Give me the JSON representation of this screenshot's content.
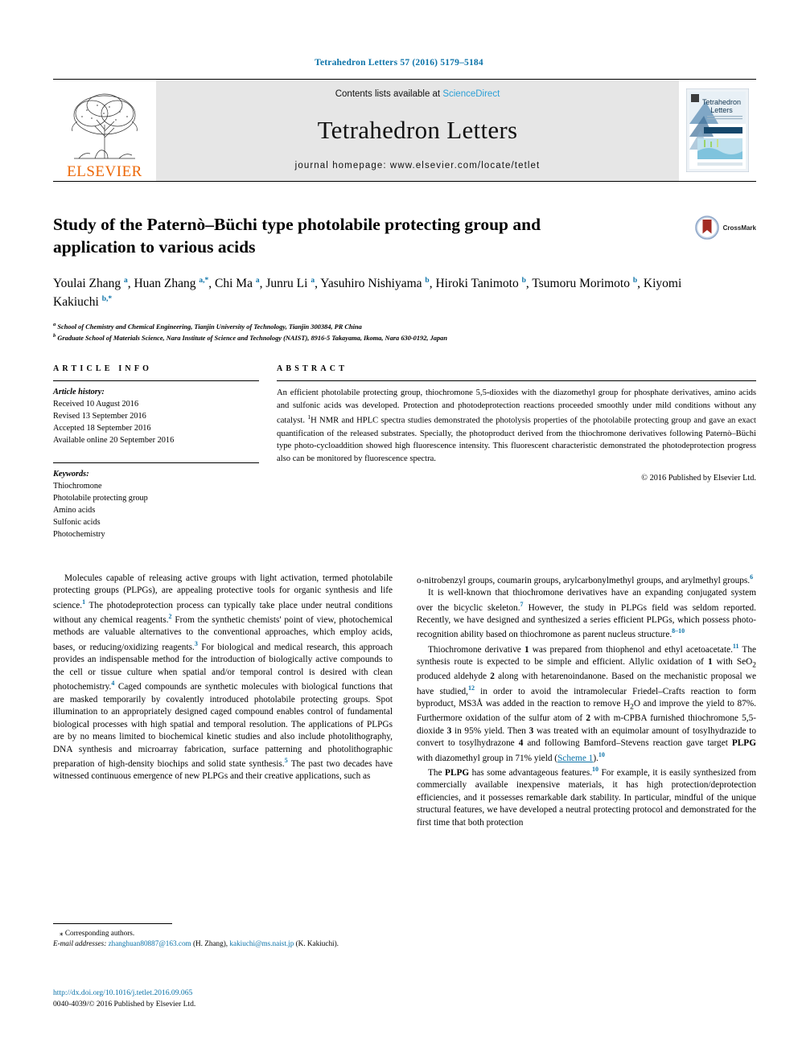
{
  "running_head": "Tetrahedron Letters 57 (2016) 5179–5184",
  "masthead": {
    "contents_prefix": "Contents lists available at ",
    "sciencedirect": "ScienceDirect",
    "journal_name": "Tetrahedron Letters",
    "homepage": "journal homepage: www.elsevier.com/locate/tetlet",
    "publisher_wordmark": "ELSEVIER",
    "cover_title_line1": "Tetrahedron",
    "cover_title_line2": "Letters",
    "accent_blue": "#0b72a8",
    "elsevier_orange": "#ec6707"
  },
  "article": {
    "title": "Study of the Paternò–Büchi type photolabile protecting group and application to various acids",
    "crossmark_label": "CrossMark",
    "authors_html": "Youlai Zhang <sup>a</sup>, Huan Zhang <sup>a,</sup><sup>*</sup>, Chi Ma <sup>a</sup>, Junru Li <sup>a</sup>, Yasuhiro Nishiyama <sup>b</sup>, Hiroki Tanimoto <sup>b</sup>, Tsumoru Morimoto <sup>b</sup>, Kiyomi Kakiuchi <sup>b,</sup><sup>*</sup>",
    "affiliation_a": "School of Chemistry and Chemical Engineering, Tianjin University of Technology, Tianjin 300384, PR China",
    "affiliation_b": "Graduate School of Materials Science, Nara Institute of Science and Technology (NAIST), 8916-5 Takayama, Ikoma, Nara 630-0192, Japan"
  },
  "info": {
    "heading": "ARTICLE INFO",
    "history_label": "Article history:",
    "history": [
      "Received 10 August 2016",
      "Revised 13 September 2016",
      "Accepted 18 September 2016",
      "Available online 20 September 2016"
    ],
    "keywords_label": "Keywords:",
    "keywords": [
      "Thiochromone",
      "Photolabile protecting group",
      "Amino acids",
      "Sulfonic acids",
      "Photochemistry"
    ]
  },
  "abstract": {
    "heading": "ABSTRACT",
    "text_html": "An efficient photolabile protecting group, thiochromone 5,5-dioxides with the diazomethyl group for phosphate derivatives, amino acids and sulfonic acids was developed. Protection and photodeprotection reactions proceeded smoothly under mild conditions without any catalyst. <sup>1</sup>H NMR and HPLC spectra studies demonstrated the photolysis properties of the photolabile protecting group and gave an exact quantification of the released substrates. Specially, the photoproduct derived from the thiochromone derivatives following Paternò–Büchi type photo-cycloaddition showed high fluorescence intensity. This fluorescent characteristic demonstrated the photodeprotection progress also can be monitored by fluorescence spectra.",
    "copyright": "© 2016 Published by Elsevier Ltd."
  },
  "body": {
    "left": [
      "Molecules capable of releasing active groups with light activation, termed photolabile protecting groups (PLPGs), are appealing protective tools for organic synthesis and life science.<sup>1</sup> The photodeprotection process can typically take place under neutral conditions without any chemical reagents.<sup>2</sup> From the synthetic chemists' point of view, photochemical methods are valuable alternatives to the conventional approaches, which employ acids, bases, or reducing/oxidizing reagents.<sup>3</sup> For biological and medical research, this approach provides an indispensable method for the introduction of biologically active compounds to the cell or tissue culture when spatial and/or temporal control is desired with clean photochemistry.<sup>4</sup> Caged compounds are synthetic molecules with biological functions that are masked temporarily by covalently introduced photolabile protecting groups. Spot illumination to an appropriately designed caged compound enables control of fundamental biological processes with high spatial and temporal resolution. The applications of PLPGs are by no means limited to biochemical kinetic studies and also include photolithography, DNA synthesis and microarray fabrication, surface patterning and photolithographic preparation of high-density biochips and solid state synthesis.<sup>5</sup> The past two decades have witnessed continuous emergence of new PLPGs and their creative applications, such as"
    ],
    "right": [
      "o-nitrobenzyl groups, coumarin groups, arylcarbonylmethyl groups, and arylmethyl groups.<sup>6</sup>",
      "It is well-known that thiochromone derivatives have an expanding conjugated system over the bicyclic skeleton.<sup>7</sup> However, the study in PLPGs field was seldom reported. Recently, we have designed and synthesized a series efficient PLPGs, which possess photo-recognition ability based on thiochromone as parent nucleus structure.<sup>8–10</sup>",
      "Thiochromone derivative <b>1</b> was prepared from thiophenol and ethyl acetoacetate.<sup>11</sup> The synthesis route is expected to be simple and efficient. Allylic oxidation of <b>1</b> with SeO<sub>2</sub> produced aldehyde <b>2</b> along with hetarenoindanone. Based on the mechanistic proposal we have studied,<sup>12</sup> in order to avoid the intramolecular Friedel–Crafts reaction to form byproduct, MS3Å was added in the reaction to remove H<sub>2</sub>O and improve the yield to 87%. Furthermore oxidation of the sulfur atom of <b>2</b> with m-CPBA furnished thiochromone 5,5-dioxide <b>3</b> in 95% yield. Then <b>3</b> was treated with an equimolar amount of tosylhydrazide to convert to tosylhydrazone <b>4</b> and following Bamford–Stevens reaction gave target <b>PLPG</b> with diazomethyl group in 71% yield (<span class=\"lnk-u\">Scheme 1</span>).<sup>10</sup>",
      "The <b>PLPG</b> has some advantageous features.<sup>10</sup> For example, it is easily synthesized from commercially available inexpensive materials, it has high protection/deprotection efficiencies, and it possesses remarkable dark stability. In particular, mindful of the unique structural features, we have developed a neutral protecting protocol and demonstrated for the first time that both protection"
    ]
  },
  "footnotes": {
    "corresponding": "Corresponding authors.",
    "email_label": "E-mail addresses:",
    "email1": "zhanghuan80887@163.com",
    "email1_owner": "(H. Zhang)",
    "email2": "kakiuchi@ms.naist.jp",
    "email2_owner": "(K. Kakiuchi)."
  },
  "footer": {
    "doi": "http://dx.doi.org/10.1016/j.tetlet.2016.09.065",
    "issn_line": "0040-4039/© 2016 Published by Elsevier Ltd."
  }
}
